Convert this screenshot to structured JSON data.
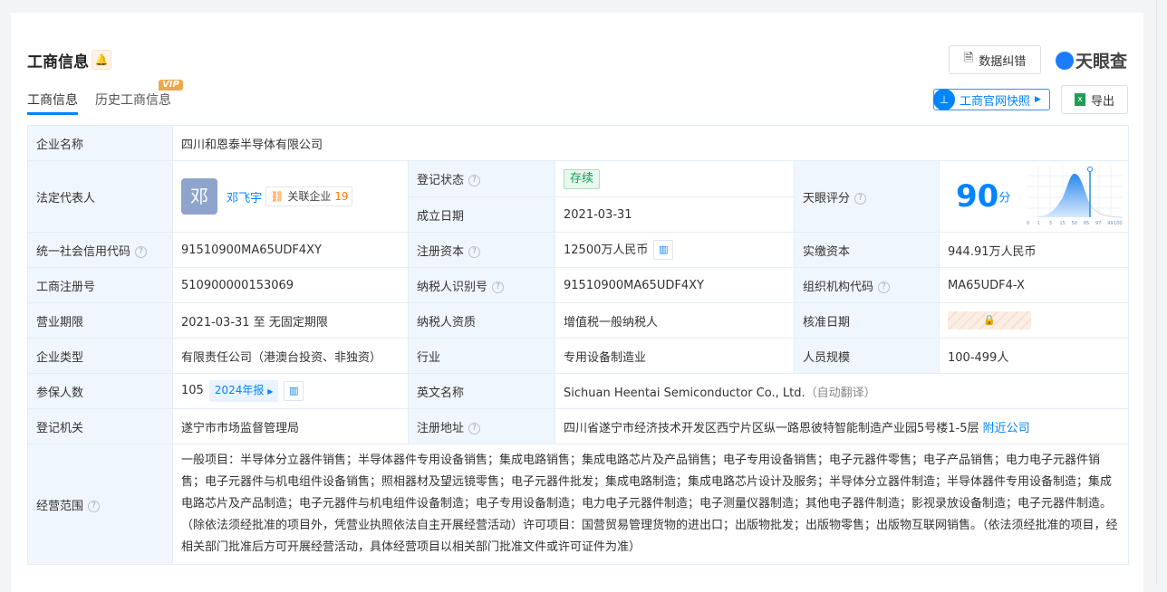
{
  "header": {
    "title": "工商信息",
    "bell_icon": "bell-icon",
    "tabs": [
      {
        "label": "工商信息",
        "active": true
      },
      {
        "label": "历史工商信息",
        "badge": "VIP"
      }
    ],
    "correction_label": "数据纠错",
    "logo_text": "天眼查",
    "snapshot_label": "工商官网快照",
    "export_label": "导出"
  },
  "colors": {
    "accent": "#0084ff",
    "status_green": "#0ba055",
    "orange": "#ff7a00"
  },
  "info": {
    "company_name_label": "企业名称",
    "company_name": "四川和恩泰半导体有限公司",
    "legal_rep_label": "法定代表人",
    "legal_rep_avatar": "邓",
    "legal_rep": "邓飞宇",
    "related_label": "关联企业",
    "related_count": "19",
    "reg_status_label": "登记状态",
    "reg_status": "存续",
    "est_date_label": "成立日期",
    "est_date": "2021-03-31",
    "score_label": "天眼评分",
    "score": "90",
    "score_unit": "分",
    "score_axis": [
      "0",
      "1",
      "3",
      "15",
      "50",
      "85",
      "97",
      "99",
      "100"
    ],
    "credit_code_label": "统一社会信用代码",
    "credit_code": "91510900MA65UDF4XY",
    "reg_capital_label": "注册资本",
    "reg_capital": "12500万人民币",
    "paid_capital_label": "实缴资本",
    "paid_capital": "944.91万人民币",
    "reg_no_label": "工商注册号",
    "reg_no": "510900000153069",
    "taxpayer_id_label": "纳税人识别号",
    "taxpayer_id": "91510900MA65UDF4XY",
    "org_code_label": "组织机构代码",
    "org_code": "MA65UDF4-X",
    "term_label": "营业期限",
    "term": "2021-03-31 至 无固定期限",
    "taxpayer_qual_label": "纳税人资质",
    "taxpayer_qual": "增值税一般纳税人",
    "approval_date_label": "核准日期",
    "company_type_label": "企业类型",
    "company_type": "有限责任公司（港澳台投资、非独资）",
    "industry_label": "行业",
    "industry": "专用设备制造业",
    "staff_size_label": "人员规模",
    "staff_size": "100-499人",
    "insured_label": "参保人数",
    "insured": "105",
    "report_tag": "2024年报",
    "english_name_label": "英文名称",
    "english_name": "Sichuan Heentai Semiconductor Co., Ltd.",
    "auto_translate": "（自动翻译）",
    "authority_label": "登记机关",
    "authority": "遂宁市市场监督管理局",
    "address_label": "注册地址",
    "address": "四川省遂宁市经济技术开发区西宁片区纵一路恩彼特智能制造产业园5号楼1-5层",
    "nearby_label": "附近公司",
    "scope_label": "经营范围",
    "scope": "一般项目：半导体分立器件销售；半导体器件专用设备销售；集成电路销售；集成电路芯片及产品销售；电子专用设备销售；电子元器件零售；电子产品销售；电力电子元器件销售；电子元器件与机电组件设备销售；照相器材及望远镜零售；电子元器件批发；集成电路制造；集成电路芯片设计及服务；半导体分立器件制造；半导体器件专用设备制造；集成电路芯片及产品制造；电子元器件与机电组件设备制造；电子专用设备制造；电力电子元器件制造；电子测量仪器制造；其他电子器件制造；影视录放设备制造；电子元器件制造。（除依法须经批准的项目外，凭营业执照依法自主开展经营活动）许可项目：国营贸易管理货物的进出口；出版物批发；出版物零售；出版物互联网销售。（依法须经批准的项目，经相关部门批准后方可开展经营活动，具体经营项目以相关部门批准文件或许可证件为准）"
  }
}
